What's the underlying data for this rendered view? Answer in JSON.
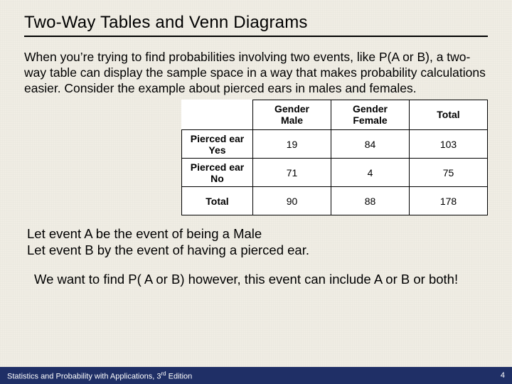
{
  "title": "Two-Way Tables and Venn Diagrams",
  "intro": "When you’re trying to find probabilities involving two events, like P(A or B), a two-way table can display the sample space in a way that makes probability calculations easier. Consider the example about pierced ears in males and females.",
  "table": {
    "col_headers": {
      "male_l1": "Gender",
      "male_l2": "Male",
      "female_l1": "Gender",
      "female_l2": "Female",
      "total": "Total"
    },
    "row_headers": {
      "yes_l1": "Pierced ear",
      "yes_l2": "Yes",
      "no_l1": "Pierced ear",
      "no_l2": "No",
      "total": "Total"
    },
    "cells": {
      "yes_male": "19",
      "yes_female": "84",
      "yes_total": "103",
      "no_male": "71",
      "no_female": "4",
      "no_total": "75",
      "tot_male": "90",
      "tot_female": "88",
      "tot_total": "178"
    }
  },
  "below_a": "Let event A be the event of being a Male",
  "below_b": "Let event B by the event of having a pierced ear.",
  "conclude": "We want to find P( A or B) however, this event can include A or B or both!",
  "footer": {
    "left_pre": "Statistics and Probability with Applications, 3",
    "left_ord": "rd",
    "left_post": " Edition",
    "page": "4"
  },
  "chart_data": {
    "type": "table",
    "title": "Pierced ear by Gender two-way table",
    "row_variable": "Pierced ear",
    "col_variable": "Gender",
    "rows": [
      "Yes",
      "No"
    ],
    "cols": [
      "Male",
      "Female"
    ],
    "values": [
      [
        19,
        84
      ],
      [
        71,
        4
      ]
    ],
    "row_totals": [
      103,
      75
    ],
    "col_totals": [
      90,
      88
    ],
    "grand_total": 178
  }
}
